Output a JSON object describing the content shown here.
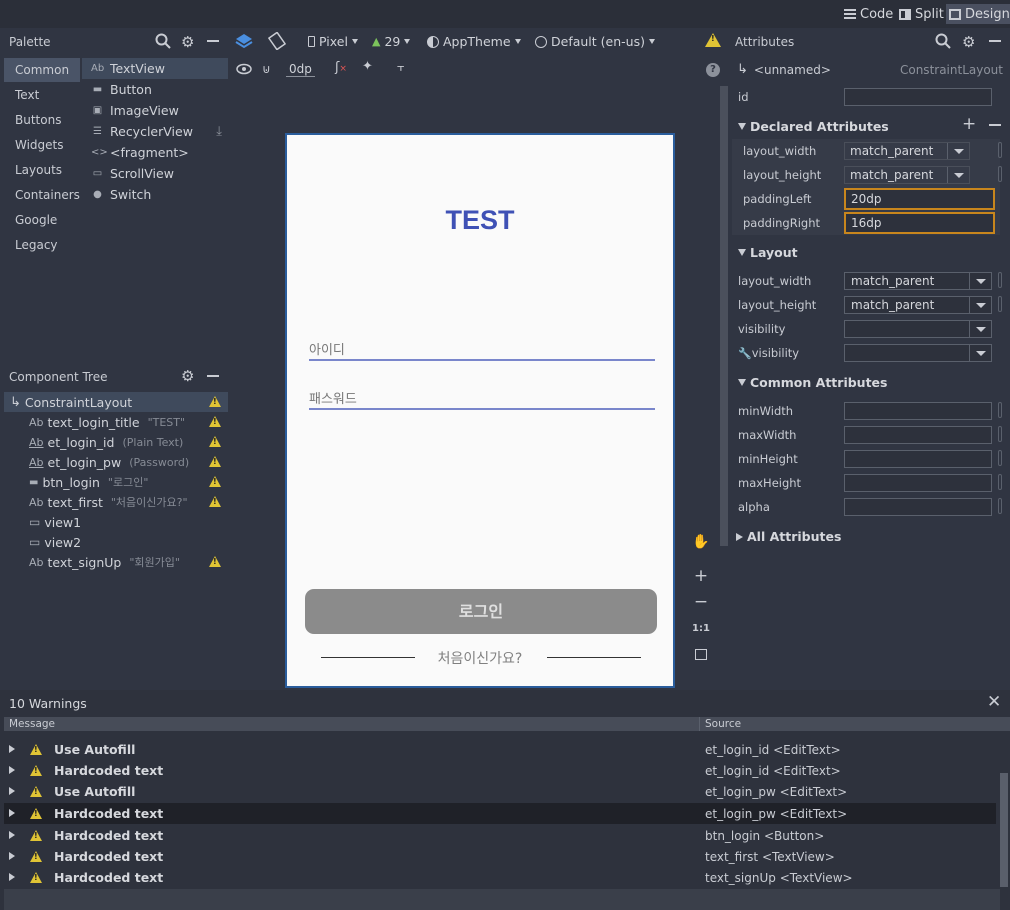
{
  "top_bar": {
    "view_modes": [
      {
        "label": "Code",
        "active": false
      },
      {
        "label": "Split",
        "active": false
      },
      {
        "label": "Design",
        "active": true
      }
    ]
  },
  "palette": {
    "title": "Palette",
    "categories": [
      "Common",
      "Text",
      "Buttons",
      "Widgets",
      "Layouts",
      "Containers",
      "Google",
      "Legacy"
    ],
    "items": [
      {
        "icon": "textview-icon",
        "glyph": "Ab",
        "label": "TextView"
      },
      {
        "icon": "button-icon",
        "glyph": "▬",
        "label": "Button"
      },
      {
        "icon": "imageview-icon",
        "glyph": "▣",
        "label": "ImageView"
      },
      {
        "icon": "recyclerview-icon",
        "glyph": "☰",
        "label": "RecyclerView"
      },
      {
        "icon": "fragment-icon",
        "glyph": "<>",
        "label": "<fragment>"
      },
      {
        "icon": "scrollview-icon",
        "glyph": "▭",
        "label": "ScrollView"
      },
      {
        "icon": "switch-icon",
        "glyph": "●",
        "label": "Switch"
      }
    ]
  },
  "design_toolbar": {
    "device": "Pixel",
    "api": "29",
    "theme": "AppTheme",
    "locale": "Default (en-us)",
    "margin": "0dp"
  },
  "component_tree": {
    "title": "Component Tree",
    "root": "ConstraintLayout",
    "nodes": [
      {
        "icon": "textview-icon",
        "glyph": "Ab",
        "name": "text_login_title",
        "sub": "\"TEST\"",
        "warn": true
      },
      {
        "icon": "edittext-icon",
        "glyph": "Ab",
        "name": "et_login_id",
        "sub": "(Plain Text)",
        "warn": true
      },
      {
        "icon": "edittext-icon",
        "glyph": "Ab",
        "name": "et_login_pw",
        "sub": "(Password)",
        "warn": true
      },
      {
        "icon": "button-icon",
        "glyph": "▬",
        "name": "btn_login",
        "sub": "\"로그인\"",
        "warn": true
      },
      {
        "icon": "textview-icon",
        "glyph": "Ab",
        "name": "text_first",
        "sub": "\"처음이신가요?\"",
        "warn": true
      },
      {
        "icon": "view-icon",
        "glyph": "▭",
        "name": "view1",
        "sub": "",
        "warn": false
      },
      {
        "icon": "view-icon",
        "glyph": "▭",
        "name": "view2",
        "sub": "",
        "warn": false
      },
      {
        "icon": "textview-icon",
        "glyph": "Ab",
        "name": "text_signUp",
        "sub": "\"회원가입\"",
        "warn": true
      }
    ]
  },
  "device_preview": {
    "title": "TEST",
    "id_hint": "아이디",
    "pw_hint": "패스워드",
    "login_button": "로그인",
    "first_text": "처음이신가요?"
  },
  "zoom_controls": [
    "+",
    "−",
    "1:1"
  ],
  "attributes": {
    "title": "Attributes",
    "component": "<unnamed>",
    "component_type": "ConstraintLayout",
    "id_label": "id",
    "id_value": "",
    "declared_header": "Declared Attributes",
    "declared": [
      {
        "name": "layout_width",
        "value": "match_parent",
        "dropdown": true
      },
      {
        "name": "layout_height",
        "value": "match_parent",
        "dropdown": true
      },
      {
        "name": "paddingLeft",
        "value": "20dp",
        "dropdown": false
      },
      {
        "name": "paddingRight",
        "value": "16dp",
        "dropdown": false
      }
    ],
    "layout_header": "Layout",
    "layout": [
      {
        "name": "layout_width",
        "value": "match_parent"
      },
      {
        "name": "layout_height",
        "value": "match_parent"
      },
      {
        "name": "visibility",
        "value": ""
      },
      {
        "name": "visibility",
        "value": "",
        "wrench": true
      }
    ],
    "common_header": "Common Attributes",
    "common": [
      {
        "name": "minWidth",
        "value": ""
      },
      {
        "name": "maxWidth",
        "value": ""
      },
      {
        "name": "minHeight",
        "value": ""
      },
      {
        "name": "maxHeight",
        "value": ""
      },
      {
        "name": "alpha",
        "value": ""
      }
    ],
    "all_header": "All Attributes"
  },
  "warnings": {
    "title": "10 Warnings",
    "col_message": "Message",
    "col_source": "Source",
    "rows": [
      {
        "message": "Use Autofill",
        "source": "et_login_id <EditText>"
      },
      {
        "message": "Hardcoded text",
        "source": "et_login_id <EditText>"
      },
      {
        "message": "Use Autofill",
        "source": "et_login_pw <EditText>"
      },
      {
        "message": "Hardcoded text",
        "source": "et_login_pw <EditText>",
        "selected": true
      },
      {
        "message": "Hardcoded text",
        "source": "btn_login <Button>"
      },
      {
        "message": "Hardcoded text",
        "source": "text_first <TextView>"
      },
      {
        "message": "Hardcoded text",
        "source": "text_signUp <TextView>"
      }
    ]
  },
  "colors": {
    "accent": "#3f51b5",
    "warning": "#e0c435",
    "highlight_border": "#c8861d",
    "selection": "#3f4a5c"
  }
}
